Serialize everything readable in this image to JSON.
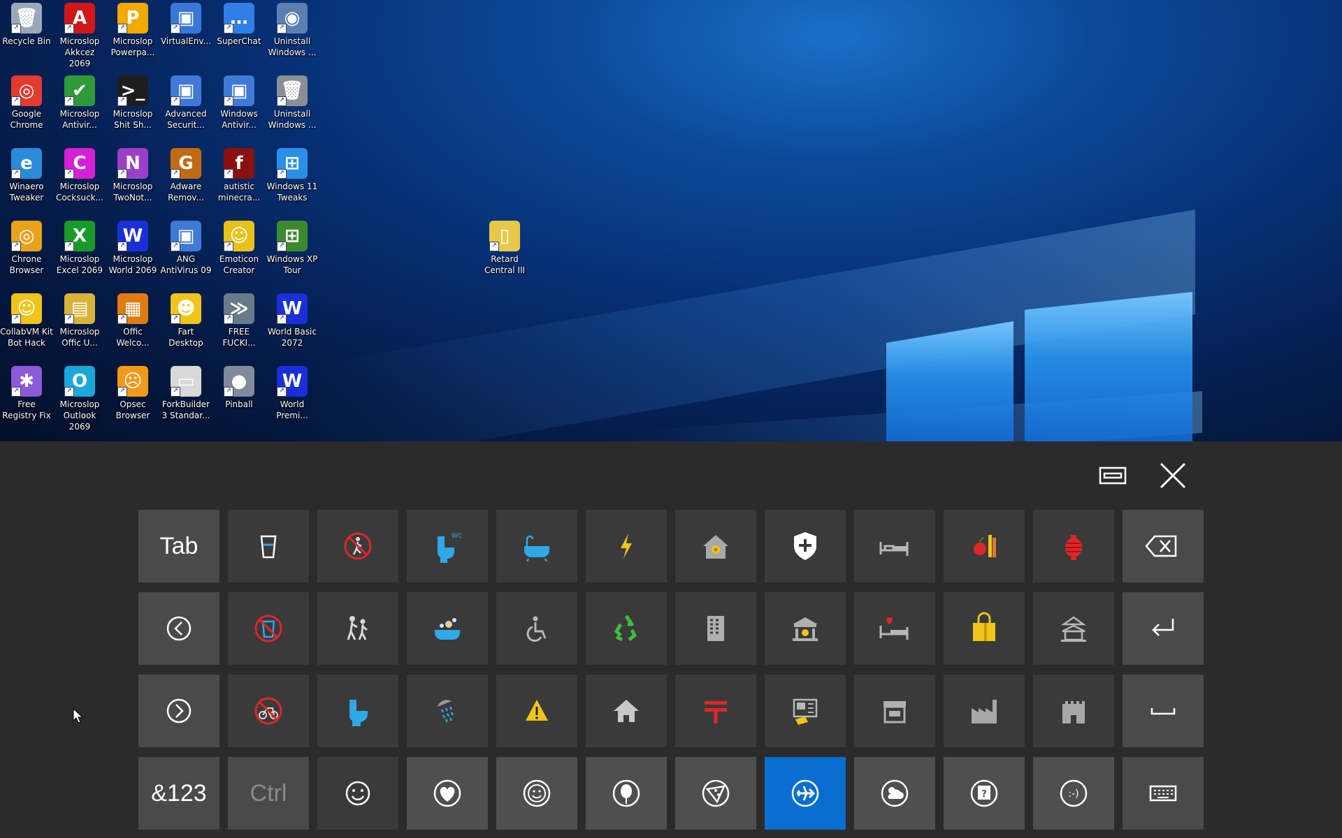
{
  "desktop": {
    "icons": [
      {
        "label": "Recycle Bin",
        "icon": "recycle-bin-icon",
        "color": "#9aa8b8",
        "glyph": "🗑"
      },
      {
        "label": "Microslop\nAkkcez 2069",
        "icon": "access-icon",
        "color": "#d01818",
        "glyph": "A"
      },
      {
        "label": "Microslop\nPowerpa...",
        "icon": "powerpoint-icon",
        "color": "#f2a900",
        "glyph": "P"
      },
      {
        "label": "VirtualEnv...",
        "icon": "virtualenv-icon",
        "color": "#3a78d8",
        "glyph": "▣"
      },
      {
        "label": "SuperChat",
        "icon": "chat-icon",
        "color": "#2f7fe6",
        "glyph": "…"
      },
      {
        "label": "Uninstall\nWindows ...",
        "icon": "uninstall-disc-icon",
        "color": "#5a7fb0",
        "glyph": "◉"
      },
      {
        "label": "Google\nChrome",
        "icon": "chrome-icon",
        "color": "#e33b2e",
        "glyph": "◎"
      },
      {
        "label": "Microslop\nAntivir...",
        "icon": "antivirus-shield-icon",
        "color": "#2e9a3a",
        "glyph": "✔"
      },
      {
        "label": "Microslop\nShit Sh...",
        "icon": "shell-icon",
        "color": "#1e1e1e",
        "glyph": ">_"
      },
      {
        "label": "Advanced\nSecurit...",
        "icon": "security-window-icon",
        "color": "#3f7ad6",
        "glyph": "▣"
      },
      {
        "label": "Windows\nAntivir...",
        "icon": "windows-antivirus-icon",
        "color": "#3f7ad6",
        "glyph": "▣"
      },
      {
        "label": "Uninstall\nWindows ...",
        "icon": "trash-can-icon",
        "color": "#8a8f96",
        "glyph": "🗑"
      },
      {
        "label": "Winaero\nTweaker",
        "icon": "winaero-icon",
        "color": "#2b8bd8",
        "glyph": "e"
      },
      {
        "label": "Microslop\nCocksuck...",
        "icon": "cocksuck-app-icon",
        "color": "#d81fd8",
        "glyph": "C"
      },
      {
        "label": "Microslop\nTwoNot...",
        "icon": "twonote-icon",
        "color": "#9b3fc8",
        "glyph": "N"
      },
      {
        "label": "Adware\nRemov...",
        "icon": "adware-icon",
        "color": "#c26a12",
        "glyph": "G"
      },
      {
        "label": "autistic\nminecra...",
        "icon": "flash-icon",
        "color": "#8a0f0f",
        "glyph": "f"
      },
      {
        "label": "Windows 11\nTweaks",
        "icon": "windows-logo-icon",
        "color": "#2a8fe6",
        "glyph": "⊞"
      },
      {
        "label": "Chrone\nBrowser",
        "icon": "chrone-browser-icon",
        "color": "#e8a21c",
        "glyph": "◎"
      },
      {
        "label": "Microslop\nExcel 2069",
        "icon": "excel-icon",
        "color": "#1a9a2a",
        "glyph": "X"
      },
      {
        "label": "Microslop\nWorld 2069",
        "icon": "word-icon",
        "color": "#1a2fd8",
        "glyph": "W"
      },
      {
        "label": "ANG\nAntiVirus 09",
        "icon": "ang-antivirus-icon",
        "color": "#3f7ad6",
        "glyph": "▣"
      },
      {
        "label": "Emoticon\nCreator",
        "icon": "emoticon-creator-icon",
        "color": "#e6c21a",
        "glyph": "☺"
      },
      {
        "label": "Windows XP\nTour",
        "icon": "windows-xp-icon",
        "color": "#3b8a2e",
        "glyph": "⊞"
      },
      {
        "label": "CollabVM Kit\nBot Hack",
        "icon": "smiley-icon",
        "color": "#f0c419",
        "glyph": "☺"
      },
      {
        "label": "Microslop\nOffic U...",
        "icon": "office-update-icon",
        "color": "#d8b23a",
        "glyph": "▤"
      },
      {
        "label": "Offic\nWelco...",
        "icon": "office-welcome-icon",
        "color": "#e07a12",
        "glyph": "▦"
      },
      {
        "label": "Fart\nDesktop",
        "icon": "grin-face-icon",
        "color": "#f0c419",
        "glyph": "☻"
      },
      {
        "label": "FREE\nFUCKI...",
        "icon": "fish-icon",
        "color": "#6a7a8a",
        "glyph": "≫"
      },
      {
        "label": "World Basic\n2072",
        "icon": "world-basic-icon",
        "color": "#1a2fd8",
        "glyph": "W"
      },
      {
        "label": "Free\nRegistry Fix",
        "icon": "registry-fix-icon",
        "color": "#8a5ad8",
        "glyph": "✱"
      },
      {
        "label": "Microslop\nOutlook 2069",
        "icon": "outlook-icon",
        "color": "#1aa8d8",
        "glyph": "O"
      },
      {
        "label": "Opsec\nBrowser",
        "icon": "opsec-face-icon",
        "color": "#f09a19",
        "glyph": "☹"
      },
      {
        "label": "ForkBuilder\n3 Standar...",
        "icon": "forkbuilder-window-icon",
        "color": "#d8d8d8",
        "glyph": "▭"
      },
      {
        "label": "Pinball",
        "icon": "pinball-icon",
        "color": "#7f8a9a",
        "glyph": "●"
      },
      {
        "label": "World\nPremi...",
        "icon": "world-premium-icon",
        "color": "#1a2fd8",
        "glyph": "W"
      }
    ],
    "extra_icon": {
      "label": "Retard\nCentral III",
      "icon": "retard-central-icon",
      "color": "#e8c84a",
      "glyph": "▯"
    }
  },
  "keyboard": {
    "toolbar": {
      "dock_icon": "dock-keyboard-icon",
      "close_icon": "close-icon"
    },
    "colors": {
      "panel": "#2b2b2b",
      "key": "#3a3a3a",
      "fn_key": "#4a4a4a",
      "selected": "#0a6ed1",
      "accent_blue": "#2fa8e8",
      "accent_red": "#e0262a",
      "accent_yellow": "#f0c419",
      "accent_green": "#3fbf3a"
    },
    "row1": {
      "tab_label": "Tab",
      "keys": [
        "cup-icon",
        "no-pedestrians-icon",
        "wc-toilet-icon",
        "bathtub-icon",
        "lightning-icon",
        "flower-house-icon",
        "shield-cross-icon",
        "bed-icon",
        "apple-pencil-icon",
        "red-lantern-icon"
      ],
      "backspace_icon": "backspace-icon"
    },
    "row2": {
      "left_icon": "arrow-left-circle-icon",
      "keys": [
        "no-drinking-icon",
        "children-crossing-icon",
        "bath-person-icon",
        "wheelchair-icon",
        "recycle-icon",
        "office-building-icon",
        "bank-icon",
        "love-hotel-icon",
        "shopping-bag-icon",
        "japanese-castle-icon"
      ],
      "enter_icon": "enter-icon"
    },
    "row3": {
      "right_icon": "arrow-right-circle-icon",
      "keys": [
        "no-bicycles-icon",
        "toilet-icon",
        "shower-icon",
        "warning-icon",
        "house-icon",
        "japanese-post-office-icon",
        "atm-icon",
        "convenience-store-icon",
        "factory-icon",
        "castle-icon"
      ],
      "space_icon": "space-icon"
    },
    "row4": {
      "num_label": "&123",
      "ctrl_label": "Ctrl",
      "emoji_keys": [
        "smiley-face-icon",
        "heart-icon",
        "smiley-category-icon",
        "balloon-icon",
        "pizza-icon",
        "airplane-icon",
        "weather-icon",
        "symbols-icon",
        "emoticon-icon"
      ],
      "keyboard_icon": "keyboard-icon"
    }
  }
}
